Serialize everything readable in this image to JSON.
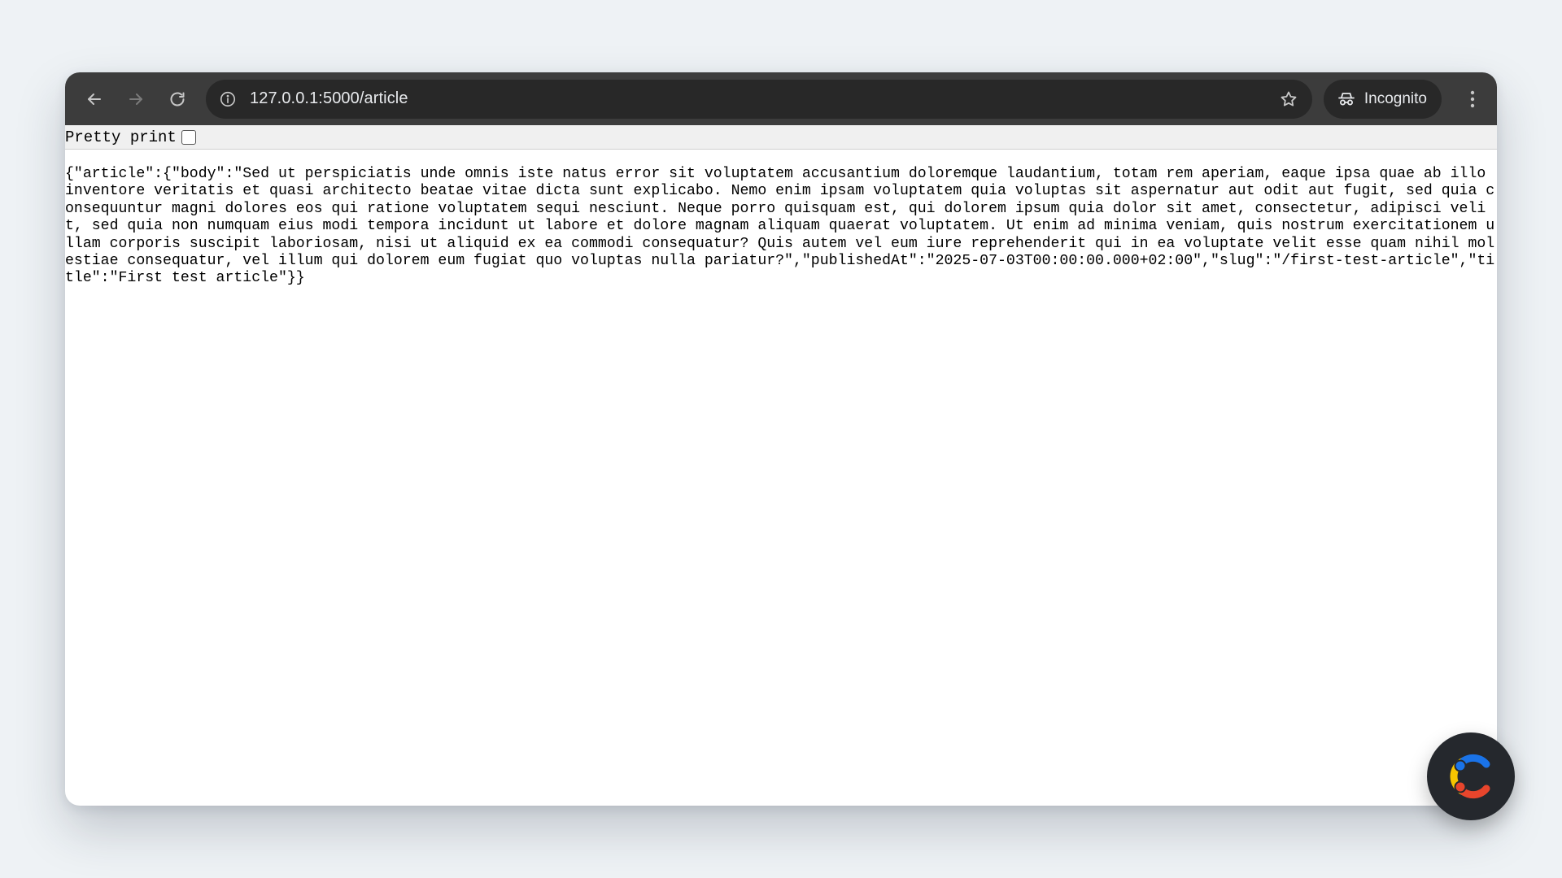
{
  "browser": {
    "url": "127.0.0.1:5000/article",
    "profile_label": "Incognito"
  },
  "json_viewer": {
    "pretty_print_label": "Pretty print",
    "pretty_print_checked": false,
    "raw_text": "{\"article\":{\"body\":\"Sed ut perspiciatis unde omnis iste natus error sit voluptatem accusantium doloremque laudantium, totam rem aperiam, eaque ipsa quae ab illo inventore veritatis et quasi architecto beatae vitae dicta sunt explicabo. Nemo enim ipsam voluptatem quia voluptas sit aspernatur aut odit aut fugit, sed quia consequuntur magni dolores eos qui ratione voluptatem sequi nesciunt. Neque porro quisquam est, qui dolorem ipsum quia dolor sit amet, consectetur, adipisci velit, sed quia non numquam eius modi tempora incidunt ut labore et dolore magnam aliquam quaerat voluptatem. Ut enim ad minima veniam, quis nostrum exercitationem ullam corporis suscipit laboriosam, nisi ut aliquid ex ea commodi consequatur? Quis autem vel eum iure reprehenderit qui in ea voluptate velit esse quam nihil molestiae consequatur, vel illum qui dolorem eum fugiat quo voluptas nulla pariatur?\",\"publishedAt\":\"2025-07-03T00:00:00.000+02:00\",\"slug\":\"/first-test-article\",\"title\":\"First test article\"}}"
  },
  "colors": {
    "toolbar_bg": "#3c3c3c",
    "omnibox_bg": "#282828",
    "logo_blue": "#1a73e8",
    "logo_yellow": "#f6c400",
    "logo_red": "#e8452c"
  }
}
